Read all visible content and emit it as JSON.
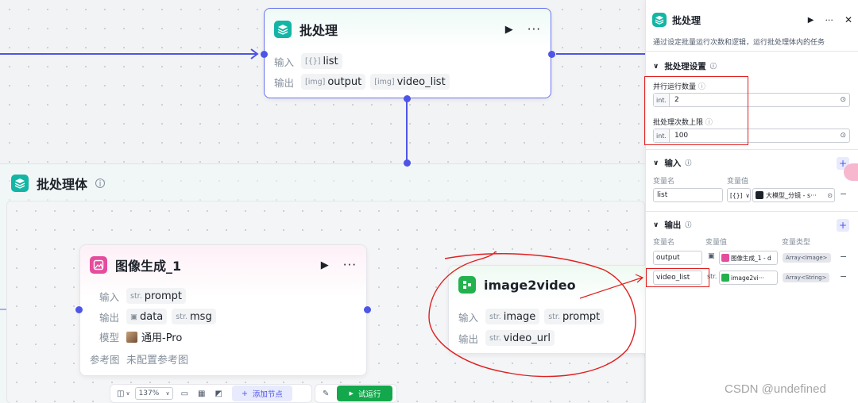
{
  "batch_node": {
    "title": "批处理",
    "input_label": "输入",
    "output_label": "输出",
    "inputs": [
      {
        "type": "[{}]",
        "name": "list"
      }
    ],
    "outputs": [
      {
        "type": "[img]",
        "name": "output"
      },
      {
        "type": "[img]",
        "name": "video_list"
      }
    ]
  },
  "batch_body": {
    "title": "批处理体"
  },
  "image_node": {
    "title": "图像生成_1",
    "input_label": "输入",
    "output_label": "输出",
    "model_label": "模型",
    "ref_label": "参考图",
    "input_type": "str.",
    "input_name": "prompt",
    "out1_name": "data",
    "out2_type": "str.",
    "out2_name": "msg",
    "model_value": "通用-Pro",
    "ref_value": "未配置参考图"
  },
  "video_node": {
    "title": "image2video",
    "input_label": "输入",
    "output_label": "输出",
    "in1_type": "str.",
    "in1_name": "image",
    "in2_type": "str.",
    "in2_name": "prompt",
    "out_type": "str.",
    "out_name": "video_url"
  },
  "panel": {
    "title": "批处理",
    "description": "通过设定批量运行次数和逻辑，运行批处理体内的任务",
    "settings_title": "批处理设置",
    "concurrency_label": "并行运行数量",
    "concurrency_type": "int.",
    "concurrency_value": "2",
    "limit_label": "批处理次数上限",
    "limit_type": "int.",
    "limit_value": "100",
    "input_title": "输入",
    "var_name_header": "变量名",
    "var_value_header": "变量值",
    "input_var_name": "list",
    "input_var_type": "[{}]",
    "input_var_ref": "大模型_分镜 - s···",
    "output_title": "输出",
    "out_name_header": "变量名",
    "out_value_header": "变量值",
    "out_type_header": "变量类型",
    "outputs": [
      {
        "name": "output",
        "ref": "图像生成_1 - d",
        "type": "Array<Image>"
      },
      {
        "name": "video_list",
        "ref": "image2vi···",
        "prefix": "str.",
        "type": "Array<String>"
      }
    ]
  },
  "toolbar": {
    "zoom": "137%",
    "add_node": "添加节点",
    "test_run": "试运行"
  },
  "watermark": "CSDN @undefined",
  "colors": {
    "accent": "#4e55e6",
    "teal": "#13b5a5",
    "pink": "#e64c9d",
    "green": "#23b14d",
    "annotation_red": "#e02020"
  }
}
